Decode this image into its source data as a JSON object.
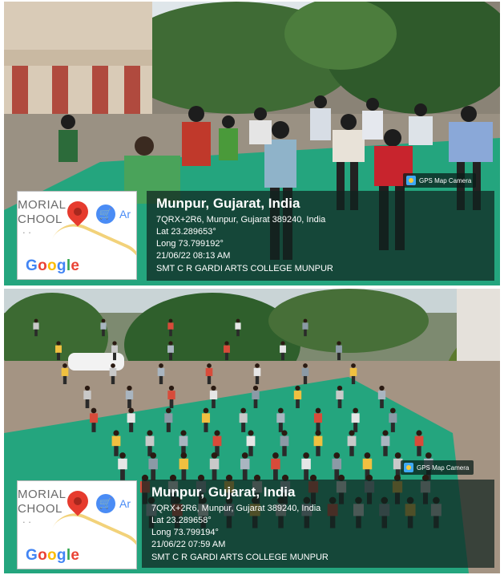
{
  "photos": [
    {
      "camera_badge": "GPS Map Camera",
      "map": {
        "line1": "MORIAL",
        "line2": "CHOOL",
        "dots": ". .",
        "partial": "Ar",
        "logo": "Google"
      },
      "place": "Munpur, Gujarat, India",
      "address": "7QRX+2R6, Munpur, Gujarat 389240, India",
      "lat": "Lat 23.289653°",
      "long": "Long 73.799192°",
      "datetime": "21/06/22 08:13 AM",
      "note": "SMT C R GARDI ARTS COLLEGE MUNPUR"
    },
    {
      "camera_badge": "GPS Map Camera",
      "map": {
        "line1": "MORIAL",
        "line2": "CHOOL",
        "dots": ". .",
        "partial": "Ar",
        "logo": "Google"
      },
      "place": "Munpur, Gujarat, India",
      "address": "7QRX+2R6, Munpur, Gujarat 389240, India",
      "lat": "Lat 23.289658°",
      "long": "Long 73.799194°",
      "datetime": "21/06/22 07:59 AM",
      "note": "SMT C R GARDI ARTS COLLEGE MUNPUR"
    }
  ]
}
